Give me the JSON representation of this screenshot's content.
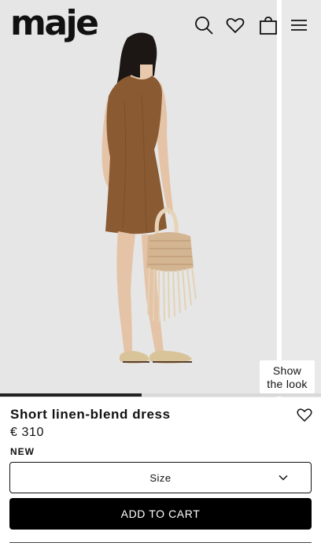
{
  "header": {
    "logo": "maje",
    "icons": [
      "search-icon",
      "heart-icon",
      "bag-icon",
      "menu-icon"
    ]
  },
  "gallery": {
    "show_look_line1": "Show",
    "show_look_line2": "the look",
    "progress": 0.44
  },
  "product": {
    "name": "Short linen-blend dress",
    "price": "€ 310",
    "badge": "NEW"
  },
  "size_select": {
    "label": "Size"
  },
  "cta": {
    "add_to_cart": "ADD TO CART"
  },
  "colors": {
    "accent": "#000000",
    "gallery_bg": "#e6e6e6",
    "dress": "#8a5a32"
  }
}
